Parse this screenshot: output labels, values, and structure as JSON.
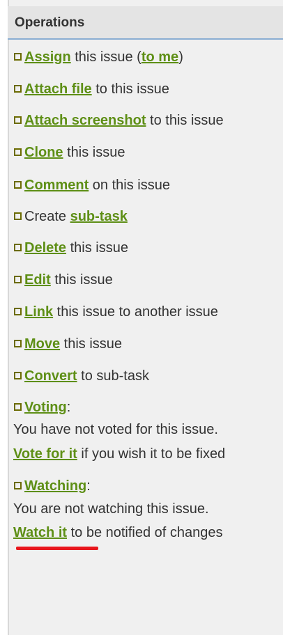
{
  "header": {
    "title": "Operations"
  },
  "operations": [
    {
      "pre": "",
      "link": "Assign",
      "mid": " this issue (",
      "link2": "to me",
      "post": ")"
    },
    {
      "pre": "",
      "link": "Attach file",
      "post": " to this issue"
    },
    {
      "pre": "",
      "link": "Attach screenshot",
      "post": " to this issue"
    },
    {
      "pre": "",
      "link": "Clone",
      "post": " this issue"
    },
    {
      "pre": "",
      "link": "Comment",
      "post": " on this issue"
    },
    {
      "pre": "Create ",
      "link": "sub-task",
      "post": ""
    },
    {
      "pre": "",
      "link": "Delete",
      "post": " this issue"
    },
    {
      "pre": "",
      "link": "Edit",
      "post": " this issue"
    },
    {
      "pre": "",
      "link": "Link",
      "post": " this issue to another issue"
    },
    {
      "pre": "",
      "link": "Move",
      "post": " this issue"
    },
    {
      "pre": "",
      "link": "Convert",
      "post": " to sub-task"
    }
  ],
  "voting": {
    "label": "Voting",
    "colon": ":",
    "status": "You have not voted for this issue.",
    "action_link": "Vote for it",
    "action_text": " if you wish it to be fixed"
  },
  "watching": {
    "label": "Watching",
    "colon": ":",
    "status": "You are not watching this issue.",
    "action_link": "Watch it",
    "action_text": " to be notified of changes"
  },
  "colors": {
    "link": "#5e8f16",
    "text": "#333333",
    "panel_bg": "#f0f0f0",
    "header_bg": "#e4e4e4",
    "header_border": "#8aaed2",
    "highlight": "#e8161c"
  }
}
